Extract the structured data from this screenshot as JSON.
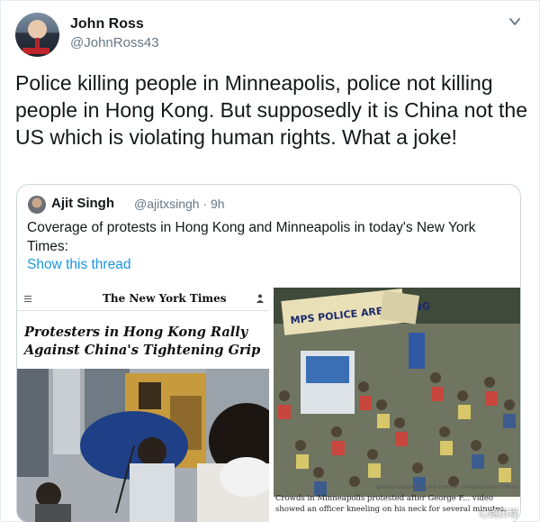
{
  "tweet": {
    "author_name": "John Ross",
    "author_handle": "@JohnRoss43",
    "text": "Police killing people in Minneapolis, police not killing people in Hong Kong. But supposedly it is China not the US which is violating human rights. What a joke!"
  },
  "quoted_tweet": {
    "author_name": "Ajit Singh",
    "author_handle": "@ajitxsingh",
    "time": "· 9h",
    "text": "Coverage of protests in Hong Kong and Minneapolis in today's New York Times:",
    "show_thread_label": "Show this thread"
  },
  "media": {
    "left": {
      "masthead": "The New York Times",
      "headline": "Protesters in Hong Kong Rally Against China's Tightening Grip"
    },
    "right": {
      "photo_credit": "CARLOS GONZALEZ/STAR TRIBUNE, VIA ASSOCIATED PRESS",
      "caption": "Crowds in Minneapolis protested after George F... video showed an officer kneeling on his neck for several minutes.",
      "sign_text": "MPS POLICE ARE KILLING",
      "watermark": "心路历程"
    }
  },
  "colors": {
    "link": "#1b95e0",
    "secondary_text": "#657786",
    "border": "#ccd6dd"
  }
}
